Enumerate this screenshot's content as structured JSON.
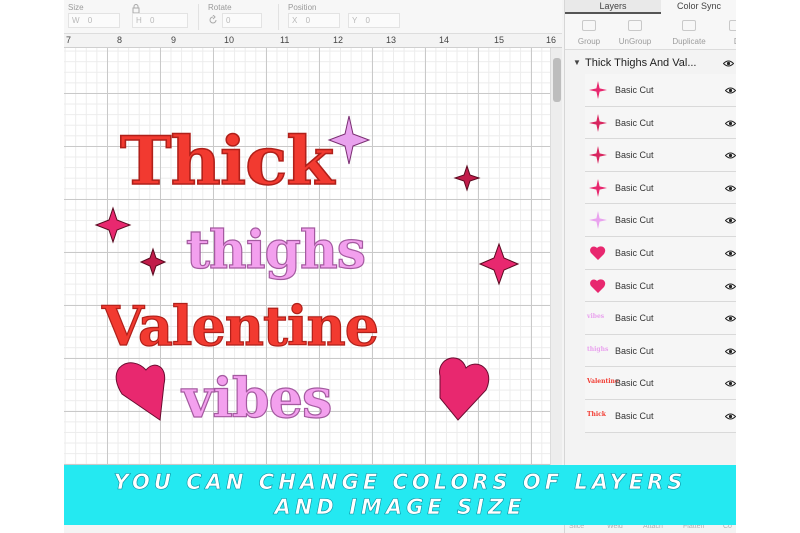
{
  "toolbar": {
    "size_label": "Size",
    "w_label": "W",
    "h_label": "H",
    "w_value": "0",
    "h_value": "0",
    "rotate_label": "Rotate",
    "rotate_value": "0",
    "position_label": "Position",
    "x_label": "X",
    "y_label": "Y",
    "x_value": "0",
    "y_value": "0"
  },
  "ruler": {
    "marks": [
      "7",
      "8",
      "9",
      "10",
      "11",
      "12",
      "13",
      "14",
      "15",
      "16"
    ]
  },
  "design": {
    "line1": "Thick",
    "line2": "thighs",
    "line3": "Valentine",
    "line4": "vibes",
    "colors": {
      "red": "#f23a30",
      "pink": "#f3a0ee",
      "magenta": "#e8286f",
      "lavender": "#e9a2ee"
    }
  },
  "panel": {
    "tabs": [
      "Layers",
      "Color Sync"
    ],
    "actions": [
      "Group",
      "UnGroup",
      "Duplicate",
      "De"
    ],
    "group_name": "Thick Thighs And Val...",
    "layers": [
      {
        "label": "Basic Cut",
        "thumb": "sparkle-icon",
        "color": "#e8286f"
      },
      {
        "label": "Basic Cut",
        "thumb": "sparkle-icon",
        "color": "#d8265f"
      },
      {
        "label": "Basic Cut",
        "thumb": "sparkle-icon",
        "color": "#d8265f"
      },
      {
        "label": "Basic Cut",
        "thumb": "sparkle-icon",
        "color": "#e8286f"
      },
      {
        "label": "Basic Cut",
        "thumb": "sparkle-icon",
        "color": "#e9a2ee"
      },
      {
        "label": "Basic Cut",
        "thumb": "heart-icon",
        "color": "#e8286f"
      },
      {
        "label": "Basic Cut",
        "thumb": "heart-icon",
        "color": "#e8286f"
      },
      {
        "label": "Basic Cut",
        "thumb": "text-thumb",
        "text": "vibes",
        "color": "#e9a2ee"
      },
      {
        "label": "Basic Cut",
        "thumb": "text-thumb",
        "text": "thighs",
        "color": "#e9a2ee"
      },
      {
        "label": "Basic Cut",
        "thumb": "text-thumb",
        "text": "Valentine",
        "color": "#f23a30"
      },
      {
        "label": "Basic Cut",
        "thumb": "text-thumb",
        "text": "Thick",
        "color": "#f23a30"
      }
    ],
    "bottom_buttons": [
      "Slice",
      "Weld",
      "Attach",
      "Flatten",
      "Co"
    ]
  },
  "banner": {
    "line1": "YOU CAN CHANGE COLORS OF LAYERS",
    "line2": "AND IMAGE SIZE",
    "color": "#24e9f1"
  }
}
